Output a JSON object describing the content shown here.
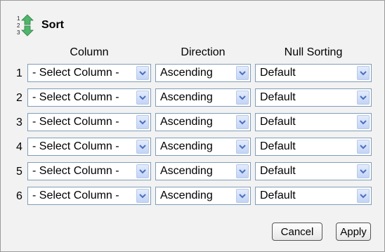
{
  "dialog": {
    "title": "Sort",
    "icon": "sort-order-icon"
  },
  "columns": {
    "column": "Column",
    "direction": "Direction",
    "null_sorting": "Null Sorting"
  },
  "rows": [
    {
      "number": "1",
      "column": "- Select Column -",
      "direction": "Ascending",
      "null_sorting": "Default"
    },
    {
      "number": "2",
      "column": "- Select Column -",
      "direction": "Ascending",
      "null_sorting": "Default"
    },
    {
      "number": "3",
      "column": "- Select Column -",
      "direction": "Ascending",
      "null_sorting": "Default"
    },
    {
      "number": "4",
      "column": "- Select Column -",
      "direction": "Ascending",
      "null_sorting": "Default"
    },
    {
      "number": "5",
      "column": "- Select Column -",
      "direction": "Ascending",
      "null_sorting": "Default"
    },
    {
      "number": "6",
      "column": "- Select Column -",
      "direction": "Ascending",
      "null_sorting": "Default"
    }
  ],
  "buttons": {
    "cancel": "Cancel",
    "apply": "Apply"
  },
  "colors": {
    "panel_bg": "#f2f2f2",
    "select_border": "#7f9db9",
    "arrow_fill": "#4a6fbf",
    "icon_green": "#3fa35a"
  }
}
